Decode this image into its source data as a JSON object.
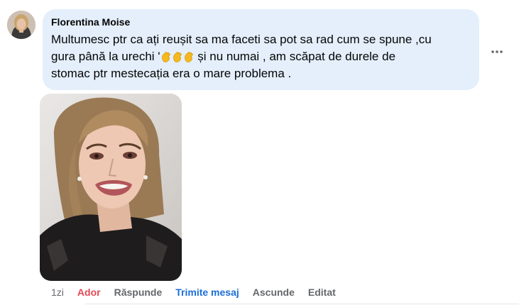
{
  "comment": {
    "author": "Florentina Moise",
    "text_line1": "Multumesc ptr ca ați reușit sa ma faceti sa pot sa rad cum se spune ,cu",
    "text_line2_before": "gura până la urechi '",
    "text_line2_after": "și nu numai , am scăpat de durele de",
    "text_line3": "stomac ptr mestecația era o mare problema .",
    "emojis": [
      "clapping-hands-emoji",
      "clapping-hands-emoji",
      "clapping-hands-emoji"
    ]
  },
  "actions": {
    "time": "1zi",
    "like": "Ador",
    "reply": "Răspunde",
    "send_message": "Trimite mesaj",
    "hide": "Ascunde",
    "edit": "Editat"
  },
  "colors": {
    "bubble": "#e4effb",
    "like_active": "#e24b55",
    "link_blue": "#1c6ed8",
    "secondary_text": "#65676b"
  },
  "icons": {
    "more": "more-horizontal-icon"
  }
}
